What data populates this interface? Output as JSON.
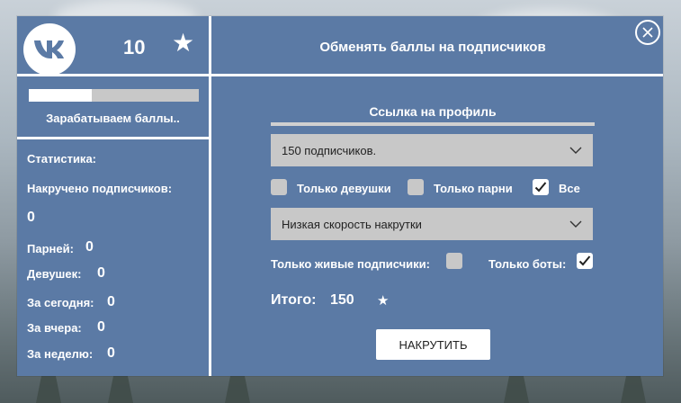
{
  "header": {
    "balance": "10",
    "title": "Обменять баллы  на подписчиков",
    "logo_icon": "vk-logo-icon",
    "star_icon": "star-icon",
    "close_icon": "close-icon"
  },
  "sidebar": {
    "progress": 0.37,
    "earning_label": "Зарабатываем баллы..",
    "stats_title": "Статистика:",
    "total_subscribers_label": "Накручено подписчиков:",
    "total_subscribers_value": "0",
    "guys_label": "Парней:",
    "guys_value": "0",
    "girls_label": "Девушек:",
    "girls_value": "0",
    "today_label": "За сегодня:",
    "today_value": "0",
    "yesterday_label": "За вчера:",
    "yesterday_value": "0",
    "week_label": "За неделю:",
    "week_value": "0"
  },
  "form": {
    "profile_link_label": "Ссылка на профиль",
    "subscribers_select": "150 подписчиков.",
    "only_girls_label": "Только девушки",
    "only_girls_checked": false,
    "only_guys_label": "Только парни",
    "only_guys_checked": false,
    "all_label": "Все",
    "all_checked": true,
    "speed_select": "Низкая скорость накрутки",
    "only_live_label": "Только живые подписчики:",
    "only_live_checked": false,
    "only_bots_label": "Только боты:",
    "only_bots_checked": true,
    "total_label": "Итого:",
    "total_value": "150",
    "submit_label": "НАКРУТИТЬ"
  },
  "colors": {
    "panel": "#5b7aa5",
    "control": "#c8c8c8",
    "text": "#ffffff"
  }
}
